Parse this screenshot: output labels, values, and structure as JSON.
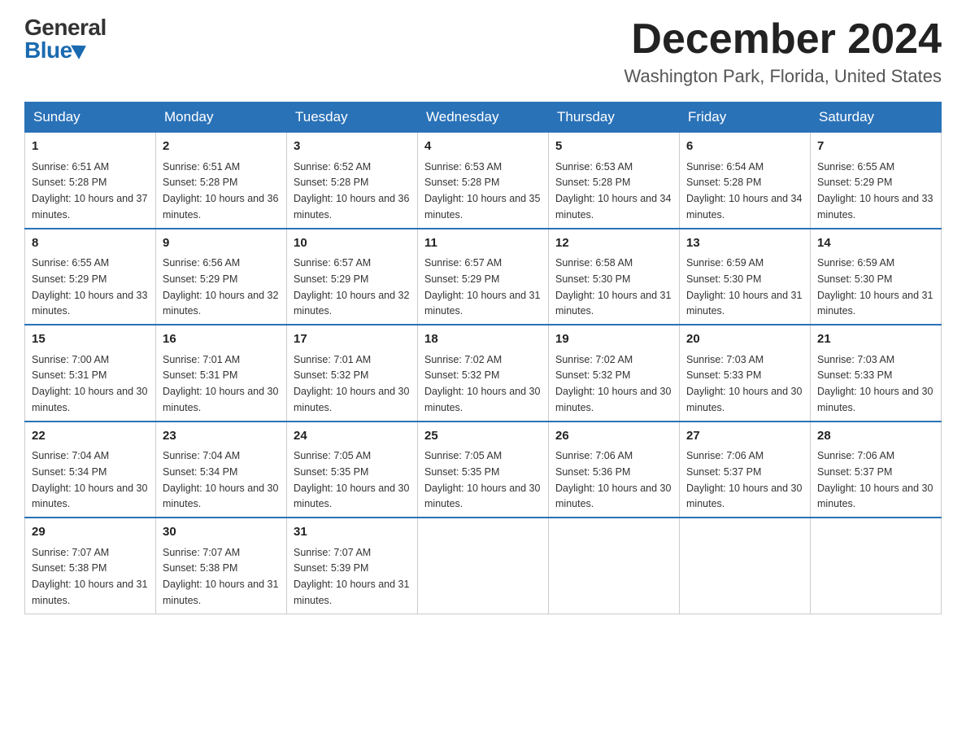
{
  "logo": {
    "general": "General",
    "blue": "Blue"
  },
  "title": {
    "month": "December 2024",
    "location": "Washington Park, Florida, United States"
  },
  "weekdays": [
    "Sunday",
    "Monday",
    "Tuesday",
    "Wednesday",
    "Thursday",
    "Friday",
    "Saturday"
  ],
  "weeks": [
    [
      {
        "day": "1",
        "sunrise": "6:51 AM",
        "sunset": "5:28 PM",
        "daylight": "10 hours and 37 minutes."
      },
      {
        "day": "2",
        "sunrise": "6:51 AM",
        "sunset": "5:28 PM",
        "daylight": "10 hours and 36 minutes."
      },
      {
        "day": "3",
        "sunrise": "6:52 AM",
        "sunset": "5:28 PM",
        "daylight": "10 hours and 36 minutes."
      },
      {
        "day": "4",
        "sunrise": "6:53 AM",
        "sunset": "5:28 PM",
        "daylight": "10 hours and 35 minutes."
      },
      {
        "day": "5",
        "sunrise": "6:53 AM",
        "sunset": "5:28 PM",
        "daylight": "10 hours and 34 minutes."
      },
      {
        "day": "6",
        "sunrise": "6:54 AM",
        "sunset": "5:28 PM",
        "daylight": "10 hours and 34 minutes."
      },
      {
        "day": "7",
        "sunrise": "6:55 AM",
        "sunset": "5:29 PM",
        "daylight": "10 hours and 33 minutes."
      }
    ],
    [
      {
        "day": "8",
        "sunrise": "6:55 AM",
        "sunset": "5:29 PM",
        "daylight": "10 hours and 33 minutes."
      },
      {
        "day": "9",
        "sunrise": "6:56 AM",
        "sunset": "5:29 PM",
        "daylight": "10 hours and 32 minutes."
      },
      {
        "day": "10",
        "sunrise": "6:57 AM",
        "sunset": "5:29 PM",
        "daylight": "10 hours and 32 minutes."
      },
      {
        "day": "11",
        "sunrise": "6:57 AM",
        "sunset": "5:29 PM",
        "daylight": "10 hours and 31 minutes."
      },
      {
        "day": "12",
        "sunrise": "6:58 AM",
        "sunset": "5:30 PM",
        "daylight": "10 hours and 31 minutes."
      },
      {
        "day": "13",
        "sunrise": "6:59 AM",
        "sunset": "5:30 PM",
        "daylight": "10 hours and 31 minutes."
      },
      {
        "day": "14",
        "sunrise": "6:59 AM",
        "sunset": "5:30 PM",
        "daylight": "10 hours and 31 minutes."
      }
    ],
    [
      {
        "day": "15",
        "sunrise": "7:00 AM",
        "sunset": "5:31 PM",
        "daylight": "10 hours and 30 minutes."
      },
      {
        "day": "16",
        "sunrise": "7:01 AM",
        "sunset": "5:31 PM",
        "daylight": "10 hours and 30 minutes."
      },
      {
        "day": "17",
        "sunrise": "7:01 AM",
        "sunset": "5:32 PM",
        "daylight": "10 hours and 30 minutes."
      },
      {
        "day": "18",
        "sunrise": "7:02 AM",
        "sunset": "5:32 PM",
        "daylight": "10 hours and 30 minutes."
      },
      {
        "day": "19",
        "sunrise": "7:02 AM",
        "sunset": "5:32 PM",
        "daylight": "10 hours and 30 minutes."
      },
      {
        "day": "20",
        "sunrise": "7:03 AM",
        "sunset": "5:33 PM",
        "daylight": "10 hours and 30 minutes."
      },
      {
        "day": "21",
        "sunrise": "7:03 AM",
        "sunset": "5:33 PM",
        "daylight": "10 hours and 30 minutes."
      }
    ],
    [
      {
        "day": "22",
        "sunrise": "7:04 AM",
        "sunset": "5:34 PM",
        "daylight": "10 hours and 30 minutes."
      },
      {
        "day": "23",
        "sunrise": "7:04 AM",
        "sunset": "5:34 PM",
        "daylight": "10 hours and 30 minutes."
      },
      {
        "day": "24",
        "sunrise": "7:05 AM",
        "sunset": "5:35 PM",
        "daylight": "10 hours and 30 minutes."
      },
      {
        "day": "25",
        "sunrise": "7:05 AM",
        "sunset": "5:35 PM",
        "daylight": "10 hours and 30 minutes."
      },
      {
        "day": "26",
        "sunrise": "7:06 AM",
        "sunset": "5:36 PM",
        "daylight": "10 hours and 30 minutes."
      },
      {
        "day": "27",
        "sunrise": "7:06 AM",
        "sunset": "5:37 PM",
        "daylight": "10 hours and 30 minutes."
      },
      {
        "day": "28",
        "sunrise": "7:06 AM",
        "sunset": "5:37 PM",
        "daylight": "10 hours and 30 minutes."
      }
    ],
    [
      {
        "day": "29",
        "sunrise": "7:07 AM",
        "sunset": "5:38 PM",
        "daylight": "10 hours and 31 minutes."
      },
      {
        "day": "30",
        "sunrise": "7:07 AM",
        "sunset": "5:38 PM",
        "daylight": "10 hours and 31 minutes."
      },
      {
        "day": "31",
        "sunrise": "7:07 AM",
        "sunset": "5:39 PM",
        "daylight": "10 hours and 31 minutes."
      },
      null,
      null,
      null,
      null
    ]
  ],
  "labels": {
    "sunrise": "Sunrise:",
    "sunset": "Sunset:",
    "daylight": "Daylight:"
  }
}
